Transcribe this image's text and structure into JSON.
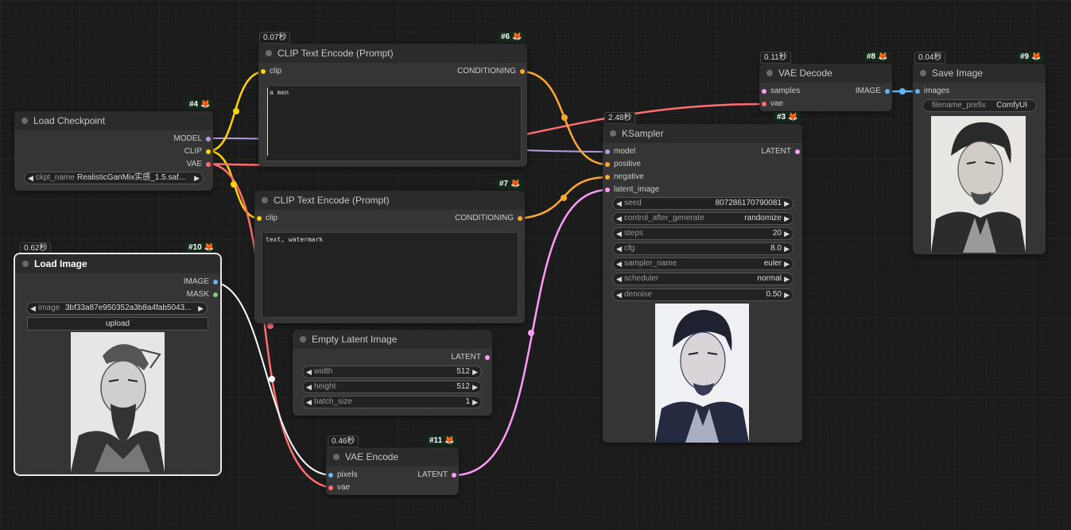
{
  "nodes": {
    "load_checkpoint": {
      "title": "Load Checkpoint",
      "id": "#4",
      "outputs": [
        "MODEL",
        "CLIP",
        "VAE"
      ],
      "widget": {
        "label": "ckpt_name",
        "value": "RealisticGanMix实感_1.5.saf..."
      }
    },
    "clip_pos": {
      "title": "CLIP Text Encode (Prompt)",
      "id": "#6",
      "time": "0.07秒",
      "input": "clip",
      "output": "CONDITIONING",
      "text": "a men"
    },
    "clip_neg": {
      "title": "CLIP Text Encode (Prompt)",
      "id": "#7",
      "input": "clip",
      "output": "CONDITIONING",
      "text": "text, watermark"
    },
    "load_image": {
      "title": "Load Image",
      "id": "#10",
      "time": "0.62秒",
      "outputs": [
        "IMAGE",
        "MASK"
      ],
      "widget": {
        "label": "image",
        "value": "3bf33a87e950352a3b8a4fab5043..."
      },
      "upload": "upload"
    },
    "empty_latent": {
      "title": "Empty Latent Image",
      "output": "LATENT",
      "widgets": [
        {
          "label": "width",
          "value": "512"
        },
        {
          "label": "height",
          "value": "512"
        },
        {
          "label": "batch_size",
          "value": "1"
        }
      ]
    },
    "vae_encode": {
      "title": "VAE Encode",
      "id": "#11",
      "time": "0.46秒",
      "inputs": [
        "pixels",
        "vae"
      ],
      "output": "LATENT"
    },
    "vae_decode": {
      "title": "VAE Decode",
      "id": "#8",
      "time": "0.11秒",
      "inputs": [
        "samples",
        "vae"
      ],
      "output": "IMAGE"
    },
    "save_image": {
      "title": "Save Image",
      "id": "#9",
      "time": "0.04秒",
      "input": "images",
      "widget": {
        "label": "filename_prefix",
        "value": "ComfyUI"
      }
    },
    "ksampler": {
      "title": "KSampler",
      "id": "#3",
      "time": "2.48秒",
      "inputs": [
        "model",
        "positive",
        "negative",
        "latent_image"
      ],
      "output": "LATENT",
      "widgets": [
        {
          "label": "seed",
          "value": "807286170790081"
        },
        {
          "label": "control_after_generate",
          "value": "randomize"
        },
        {
          "label": "steps",
          "value": "20"
        },
        {
          "label": "cfg",
          "value": "8.0"
        },
        {
          "label": "sampler_name",
          "value": "euler"
        },
        {
          "label": "scheduler",
          "value": "normal"
        },
        {
          "label": "denoise",
          "value": "0.50"
        }
      ]
    }
  },
  "colors": {
    "model": "#b39ddb",
    "clip": "#ffd500",
    "vae": "#ff6e6e",
    "conditioning": "#ffa931",
    "latent": "#ff9cf9",
    "image": "#64b5f6",
    "mask": "#81c784"
  }
}
